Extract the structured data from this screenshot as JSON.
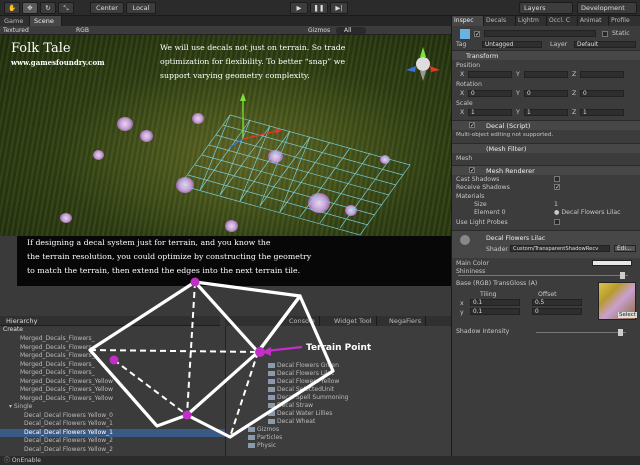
{
  "toolbar": {
    "pivot_label": "Center",
    "space_label": "Local",
    "layers_label": "Layers",
    "layout_label": "Development"
  },
  "scene": {
    "tabs": [
      "Game",
      "Scene"
    ],
    "shading": "Textured",
    "render_mode": "RGB",
    "gizmos_label": "Gizmos",
    "search_label": "All"
  },
  "overlay": {
    "title": "Folk Tale",
    "url": "www.gamesfoundry.com",
    "caption_top": [
      "We will use decals not just on terrain.  So trade",
      "optimization for flexibility.  To better “snap” we",
      "support varying geometry complexity."
    ],
    "caption_bottom": [
      "If designing a decal system just for terrain, and you know the",
      "the terrain resolution, you could optimize by constructing the geometry",
      "to match the terrain, then extend the edges into the next terrain tile."
    ],
    "diagram_label": "Terrain Point"
  },
  "hierarchy": {
    "tab": "Hierarchy",
    "create_label": "Create",
    "rows": [
      "Merged_Decals_Flowers_",
      "Merged_Decals_Flowers_",
      "Merged_Decals_Flowers_",
      "Merged_Decals_Flowers_",
      "Merged_Decals_Flowers_",
      "Merged_Decals_Flowers_Yellow",
      "Merged_Decals_Flowers_Yellow",
      "Merged_Decals_Flowers_Yellow",
      "Single",
      "Decal_Decal Flowers Yellow_0",
      "Decal_Decal Flowers Yellow_1",
      "Decal_Decal Flowers Yellow_1",
      "Decal_Decal Flowers Yellow_2",
      "Decal_Decal Flowers Yellow_2"
    ],
    "selected_index": 11
  },
  "project": {
    "tabs": [
      "Console",
      "Widget Tool",
      "NegaFiers"
    ],
    "rows": [
      "Decal Flowers Green",
      "Decal Flowers Lilac",
      "Decal Flowers Yellow",
      "Decal SelectedUnit",
      "Decal Spell Summoning",
      "Decal Straw",
      "Decal Water Lillies",
      "Decal Wheat",
      "Gizmos",
      "Particles",
      "Physic"
    ]
  },
  "inspector": {
    "tabs": [
      "Inspec",
      "Decals",
      "Lightm",
      "Occl. C",
      "Animat",
      "Profile"
    ],
    "static_label": "Static",
    "tag_label": "Tag",
    "tag_value": "Untagged",
    "layer_label": "Layer",
    "layer_value": "Default",
    "transform_label": "Transform",
    "position_label": "Position",
    "rotation_label": "Rotation",
    "scale_label": "Scale",
    "pos": {
      "x": "",
      "y": "",
      "z": ""
    },
    "rot": {
      "x": "0",
      "y": "0",
      "z": "0"
    },
    "scale": {
      "x": "1",
      "y": "1",
      "z": "1"
    },
    "decal_script": "Decal (Script)",
    "multi_note": "Multi-object editing not supported.",
    "mesh_filter": "(Mesh Filter)",
    "mesh_label": "Mesh",
    "mesh_renderer": "Mesh Renderer",
    "cast_shadows": "Cast Shadows",
    "receive_shadows": "Receive Shadows",
    "materials": "Materials",
    "size_label": "Size",
    "size_value": "1",
    "element0_label": "Element 0",
    "element0_value": "Decal Flowers Lilac",
    "light_probes": "Use Light Probes",
    "material_name": "Decal Flowers Lilac",
    "shader_label": "Shader",
    "shader_value": "Custom/TransparentShadowRecv",
    "edit_label": "Edi...",
    "main_color": "Main Color",
    "shininess": "Shininess",
    "base_label": "Base (RGB) TransGloss (A)",
    "tiling_label": "Tiling",
    "offset_label": "Offset",
    "tiling_x": "0.1",
    "tiling_y": "0.1",
    "offset_x": "0.5",
    "offset_y": "0",
    "select_label": "Select",
    "shadow_intensity": "Shadow Intensity"
  },
  "status": {
    "text": "OnEnable"
  }
}
